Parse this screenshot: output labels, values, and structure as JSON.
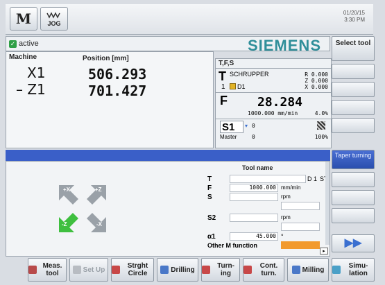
{
  "topbar": {
    "machine_btn": "M",
    "jog_btn": "JOG",
    "date": "01/20/15",
    "time": "3:30 PM"
  },
  "status": {
    "state": "active",
    "brand": "SIEMENS"
  },
  "right_softkeys": {
    "select_tool": "Select tool",
    "taper_turning": "Taper turning"
  },
  "position": {
    "col_machine": "Machine",
    "col_position": "Position [mm]",
    "rows": [
      {
        "axis": "X1",
        "value": "506.293"
      },
      {
        "axis": "– Z1",
        "value": "701.427"
      }
    ]
  },
  "tfs": {
    "title": "T,F,S",
    "t_label": "T",
    "tool_name": "SCHRUPPER",
    "r_val": "R 0.000",
    "z_val": "Z 0.000",
    "x_val": "X 0.000",
    "tool_num": "1",
    "d_label": "D1",
    "f_label": "F",
    "f_value": "28.284",
    "f_sub": "1000.000 mm/min",
    "f_pct": "4.0%",
    "s_label": "S1",
    "s_value": "0",
    "master": "Master",
    "master_val": "0",
    "master_pct": "100%"
  },
  "form": {
    "tool_name_hdr": "Tool name",
    "t_label": "T",
    "d_value": "D 1",
    "st_label": "ST",
    "f_label": "F",
    "f_value": "1000.000",
    "f_unit": "mm/min",
    "s_label": "S",
    "s_unit": "rpm",
    "s2_label": "S2",
    "s2_unit": "rpm",
    "alpha_label": "α1",
    "alpha_value": "45.000",
    "alpha_unit": "°",
    "other_m": "Other M function"
  },
  "jog_arrows": {
    "plus_x": "+X",
    "plus_z": "+Z",
    "minus_z": "-Z",
    "minus_x": "-X"
  },
  "bottom_softkeys": [
    "Meas. tool",
    "Set Up",
    "Strght Circle",
    "Drilling",
    "Turn- ing",
    "Cont. turn.",
    "Milling",
    "Simu- lation"
  ],
  "colors": {
    "brand": "#2f8f9a",
    "active_blue": "#3a5fc8",
    "jog_green": "#3fbf3f",
    "orange_field": "#f29a2e"
  }
}
